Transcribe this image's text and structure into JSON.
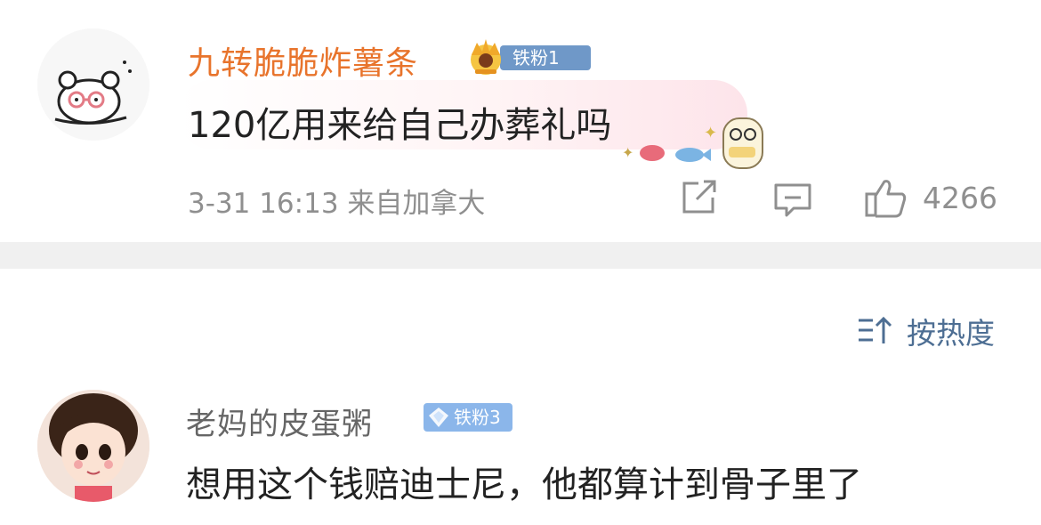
{
  "comment_1": {
    "username": "九转脆脆炸薯条",
    "fan_badge": "铁粉1",
    "text": "120亿用来给自己办葬礼吗",
    "meta": "3-31 16:13 来自加拿大",
    "like_count": "4266",
    "icons": [
      "avatar-hamster-icon",
      "crown-icon",
      "sticker-icon",
      "share-icon",
      "comment-icon",
      "like-icon"
    ]
  },
  "sort": {
    "label": "按热度",
    "icon": "sort-icon"
  },
  "comment_2": {
    "username": "老妈的皮蛋粥",
    "fan_badge": "铁粉3",
    "text": "想用这个钱赔迪士尼，他都算计到骨子里了",
    "icons": [
      "avatar-girl-icon",
      "diamond-icon"
    ]
  },
  "colors": {
    "username_vip": "#e8742c",
    "username_normal": "#666666",
    "fan_badge_1": "#6f98c8",
    "fan_badge_3": "#8bb6ea",
    "meta_gray": "#8f8f8f",
    "sort_blue": "#4d6e93",
    "divider": "#f0f0f0"
  }
}
